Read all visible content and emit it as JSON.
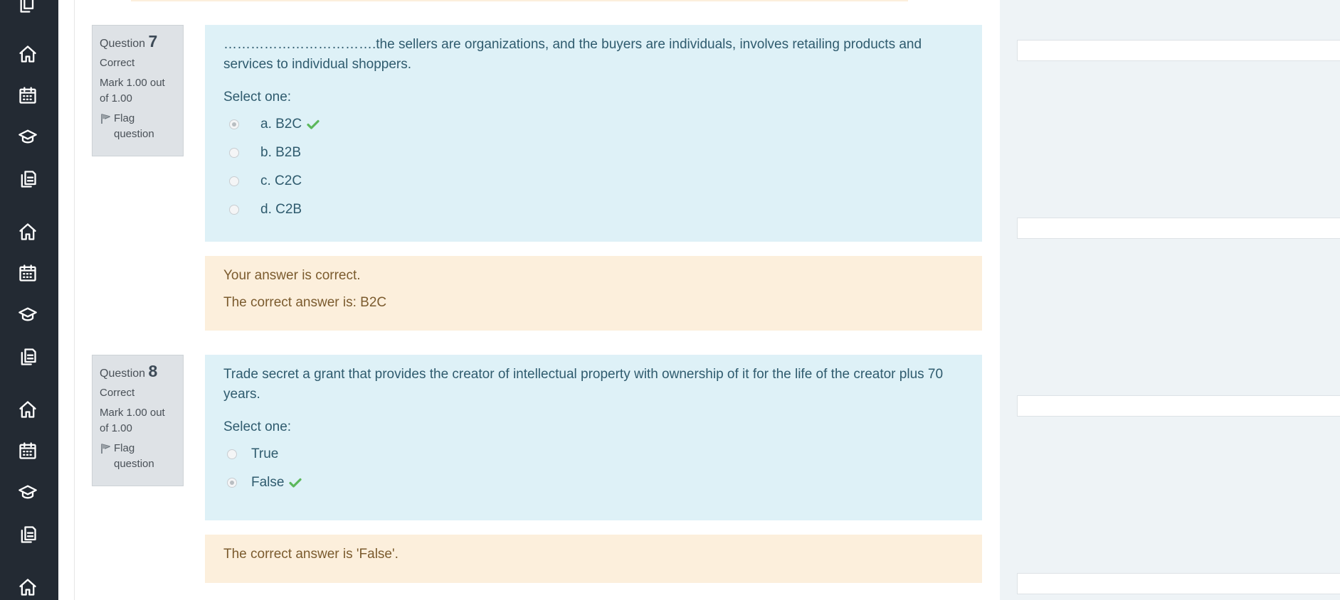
{
  "rail": {
    "icons": [
      "document-icon",
      "home-icon",
      "calendar-icon",
      "graduation-cap-icon",
      "copy-icon",
      "home-icon",
      "calendar-icon",
      "graduation-cap-icon",
      "copy-icon",
      "home-icon",
      "calendar-icon",
      "graduation-cap-icon",
      "copy-icon",
      "home-icon"
    ]
  },
  "questions": [
    {
      "label": "Question",
      "number": "7",
      "state": "Correct",
      "grade": "Mark 1.00 out of 1.00",
      "flag": "Flag question",
      "text": "…………………………….the sellers are organizations, and the buyers are individuals, involves retailing products and services to individual shoppers.",
      "prompt": "Select one:",
      "answers": [
        {
          "label": "a. B2C",
          "checked": true,
          "correct": true
        },
        {
          "label": "b. B2B",
          "checked": false,
          "correct": false
        },
        {
          "label": "c. C2C",
          "checked": false,
          "correct": false
        },
        {
          "label": "d. C2B",
          "checked": false,
          "correct": false
        }
      ],
      "feedback": [
        "Your answer is correct.",
        "The correct answer is: B2C"
      ]
    },
    {
      "label": "Question",
      "number": "8",
      "state": "Correct",
      "grade": "Mark 1.00 out of 1.00",
      "flag": "Flag question",
      "text": "Trade secret a grant that provides the creator of intellectual property with ownership of it for the life of the creator plus 70 years.",
      "prompt": "Select one:",
      "answers": [
        {
          "label": "True",
          "checked": false,
          "correct": false
        },
        {
          "label": "False",
          "checked": true,
          "correct": true
        }
      ],
      "feedback": [
        "The correct answer is 'False'."
      ]
    }
  ],
  "colors": {
    "rail": "#232a33",
    "question_bg": "#def1f7",
    "feedback_bg": "#fcefdc",
    "info_bg": "#dee2e6",
    "check": "#5cb85c"
  }
}
